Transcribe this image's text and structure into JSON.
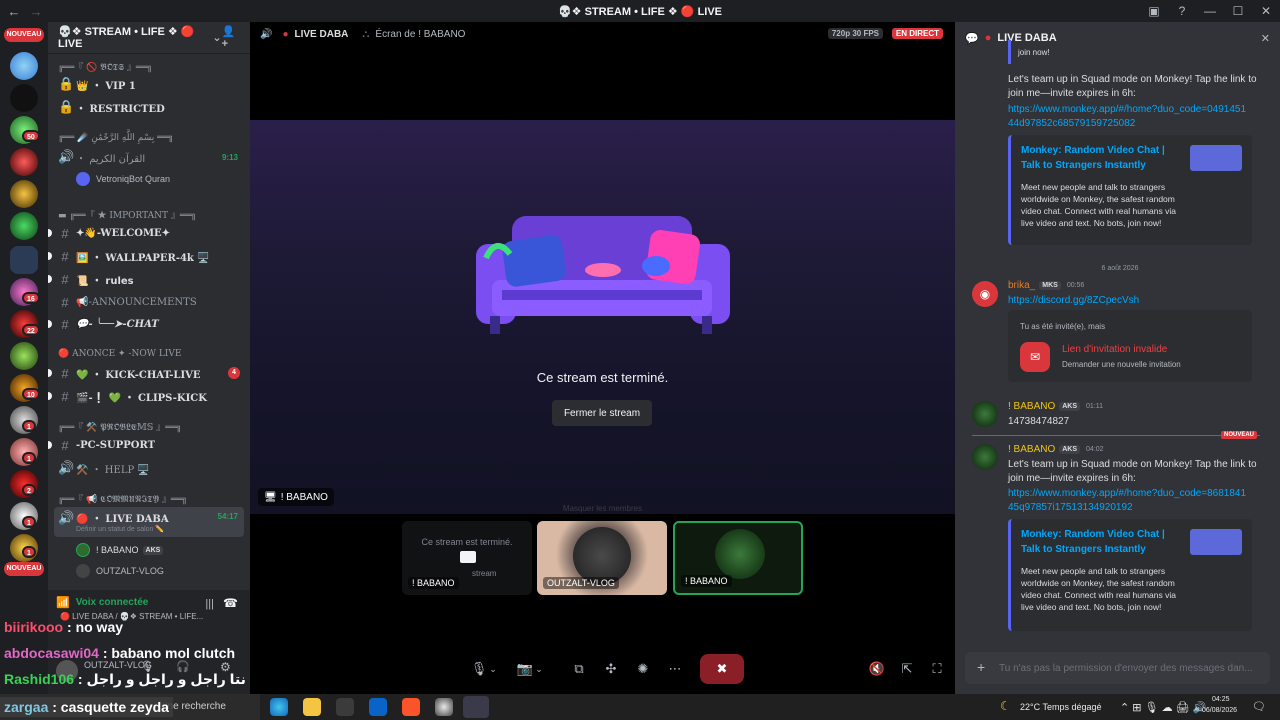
{
  "window": {
    "title": "💀❖ STREAM • LIFE ❖ 🔴 LIVE"
  },
  "rail": {
    "new_badge_top": "NOUVEAU",
    "new_badge_bottom": "NOUVEAU",
    "badges": [
      "50",
      "16",
      "22",
      "10",
      "1",
      "1",
      "2",
      "1",
      "1"
    ]
  },
  "server": {
    "name": "💀❖ STREAM • LIFE ❖ 🔴 LIVE",
    "channels": [
      {
        "label": "╔══『 🚫 𝕭𝕺𝕿𝕾 』══╗",
        "type": "category"
      },
      {
        "label": "👑 ・ VIP 1",
        "type": "locked"
      },
      {
        "label": "・ RESTRICTED",
        "type": "locked"
      },
      {
        "label": "╔══ ☄️ بِسْمِ اللَّهِ الرَّحْمَٰنِ ══╗",
        "type": "category"
      },
      {
        "label": "・ القرآن الكريم",
        "type": "voice",
        "time": "9:13"
      },
      {
        "label": "VetroniqBot Quran",
        "type": "voice-user"
      },
      {
        "label": "▬ ╔══『 ★ IMPORTANT 』══╗",
        "type": "category"
      },
      {
        "label": "✦👋-WELCOME✦",
        "type": "text"
      },
      {
        "label": "🖼️ ・ WALLPAPER-4k 🖥️",
        "type": "text"
      },
      {
        "label": "📜 ・ rules",
        "type": "text"
      },
      {
        "label": "📢-ANNOUNCEMENTS",
        "type": "text"
      },
      {
        "label": "💬- ╰──➤-CHAT",
        "type": "text"
      },
      {
        "label": "🔴 ANONCE ✦ -NOW LIVE",
        "type": "category"
      },
      {
        "label": "💚 ・ KICK-CHAT-LIVE",
        "type": "text",
        "count": "4"
      },
      {
        "label": "🎬-❕ 💚 ・ CLIPS-KICK",
        "type": "text"
      },
      {
        "label": "╔══『 ⚒️ 𝕻𝕽𝕺𝕭𝕷𝕰𝕄𝕊 』══╗",
        "type": "category"
      },
      {
        "label": "-PC-SUPPORT",
        "type": "text"
      },
      {
        "label": "⚒️ ・ HELP 🖥️",
        "type": "voice"
      },
      {
        "label": "╔══『 📢 𝕮𝕺𝕸𝕸𝖀𝕹𝕴𝕿𝖄 』══╗",
        "type": "category"
      },
      {
        "label": "🔴 ・ LIVE DABA",
        "type": "voice-active",
        "time": "54:17"
      },
      {
        "label": "Définir un statut de salon ✏️",
        "type": "status"
      },
      {
        "label": "! BABANO",
        "type": "voice-user",
        "tag": "AKS"
      },
      {
        "label": "OUTZALT-VLOG",
        "type": "voice-user"
      }
    ]
  },
  "voice_panel": {
    "status": "Voix connectée",
    "channel": "🔴 LIVE DABA / 💀❖ STREAM • LIFE..."
  },
  "user_panel": {
    "name": "OUTZALT-VLOG"
  },
  "overlay_chat": [
    {
      "user": "biirikooo",
      "text": " : no way",
      "color": "#ff4d6d",
      "bg": "#2a1e2e"
    },
    {
      "user": "abdocasawi04",
      "text": " : babano mol clutch",
      "color": "#e267c8",
      "bg": "#2a1e30"
    },
    {
      "user": "Rashid106",
      "text": " : نتا راجل و راجل و راجل",
      "color": "#39d353",
      "bg": "#15261a"
    },
    {
      "user": "zargaa",
      "text": " : casquette zeyda",
      "color": "#7ec8e3",
      "bg": "#333333"
    }
  ],
  "stream": {
    "top_channel": "LIVE DABA",
    "top_screen": "Écran de ! BABANO",
    "quality": "720p 30 FPS",
    "live_tag": "EN DIRECT",
    "ended_message": "Ce stream est terminé.",
    "close_button": "Fermer le stream",
    "stage_tag": "! BABANO",
    "hint": "Masquer les membres",
    "tiles": [
      {
        "label": "! BABANO",
        "overlay_text": "Ce stream est terminé.",
        "overlay_sub": "stream"
      },
      {
        "label": "OUTZALT-VLOG"
      },
      {
        "label": "! BABANO"
      }
    ]
  },
  "chat": {
    "title": "LIVE DABA",
    "top_fragment": "join now!",
    "msg1_text": "Let's team up in Squad mode on Monkey! Tap the link to join me—invite expires in 6h:",
    "msg1_link": "https://www.monkey.app/#/home?duo_code=049145144d97852c68579159725082",
    "embed1": {
      "title": "Monkey: Random Video Chat | Talk to Strangers Instantly",
      "desc": "Meet new people and talk to strangers worldwide on Monkey, the safest random video chat. Connect with real humans via live video and text. No bots, join now!"
    },
    "date_divider": "6 août 2026",
    "msg2": {
      "author": "brika_",
      "tag": "MKS",
      "time": "00:56",
      "link": "https://discord.gg/8ZCpecVsh",
      "invite_header": "Tu as été invité(e), mais",
      "invite_title": "Lien d'invitation invalide",
      "invite_sub": "Demander une nouvelle invitation"
    },
    "msg3": {
      "author": "! BABANO",
      "tag": "AKS",
      "time": "01:11",
      "text": "14738474827"
    },
    "new_label": "NOUVEAU",
    "msg4": {
      "author": "! BABANO",
      "tag": "AKS",
      "time": "04:02",
      "text": "Let's team up in Squad mode on Monkey! Tap the link to join me—invite expires in 6h:",
      "link": "https://www.monkey.app/#/home?duo_code=868184145q97857i17513134920192"
    },
    "embed2": {
      "title": "Monkey: Random Video Chat | Talk to Strangers Instantly",
      "desc": "Meet new people and talk to strangers worldwide on Monkey, the safest random video chat. Connect with real humans via live video and text. No bots, join now!"
    },
    "input_placeholder": "Tu n'as pas la permission d'envoyer des messages dan..."
  },
  "taskbar": {
    "search": "une recherche",
    "weather": "22°C  Temps dégagé",
    "time": "04:25",
    "date": "06/08/2026"
  }
}
